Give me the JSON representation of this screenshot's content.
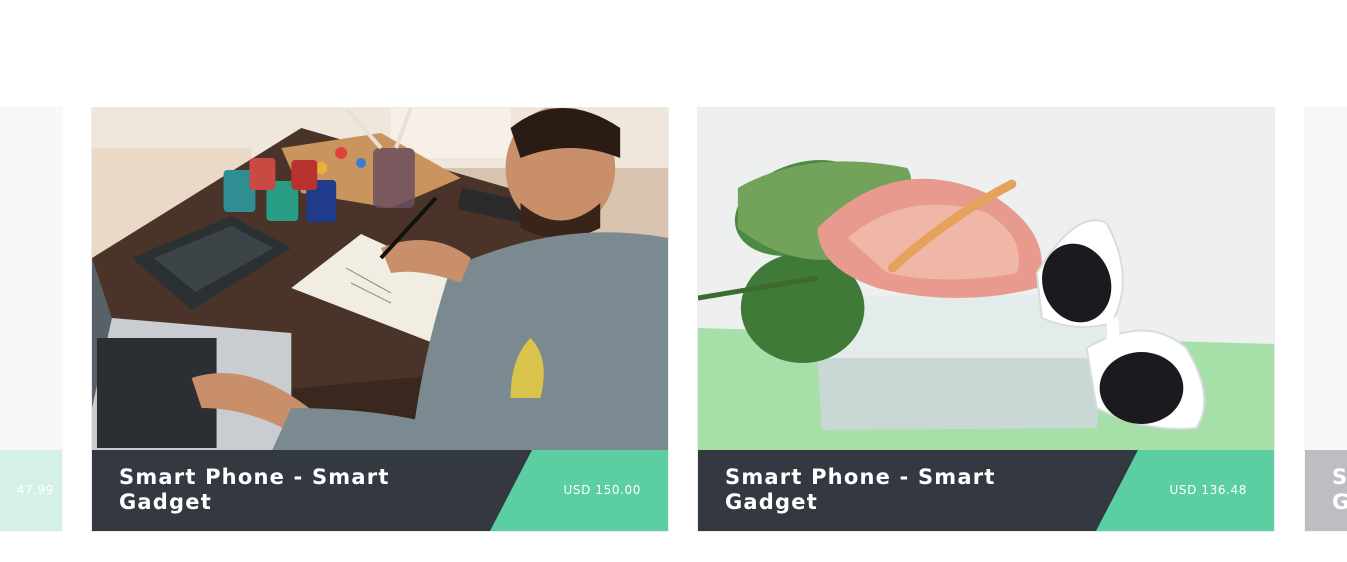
{
  "products": [
    {
      "title": "",
      "price": "47.99"
    },
    {
      "title": "Smart Phone - Smart Gadget",
      "price": "USD 150.00",
      "image": "artist-sketching-at-desk"
    },
    {
      "title": "Smart Phone - Smart Gadget",
      "price": "USD 136.48",
      "image": "anthurium-flower-and-sunglasses"
    },
    {
      "title": "S G",
      "price": ""
    }
  ],
  "colors": {
    "footer": "#343840",
    "accent": "#5bcfa2",
    "text": "#ffffff"
  }
}
